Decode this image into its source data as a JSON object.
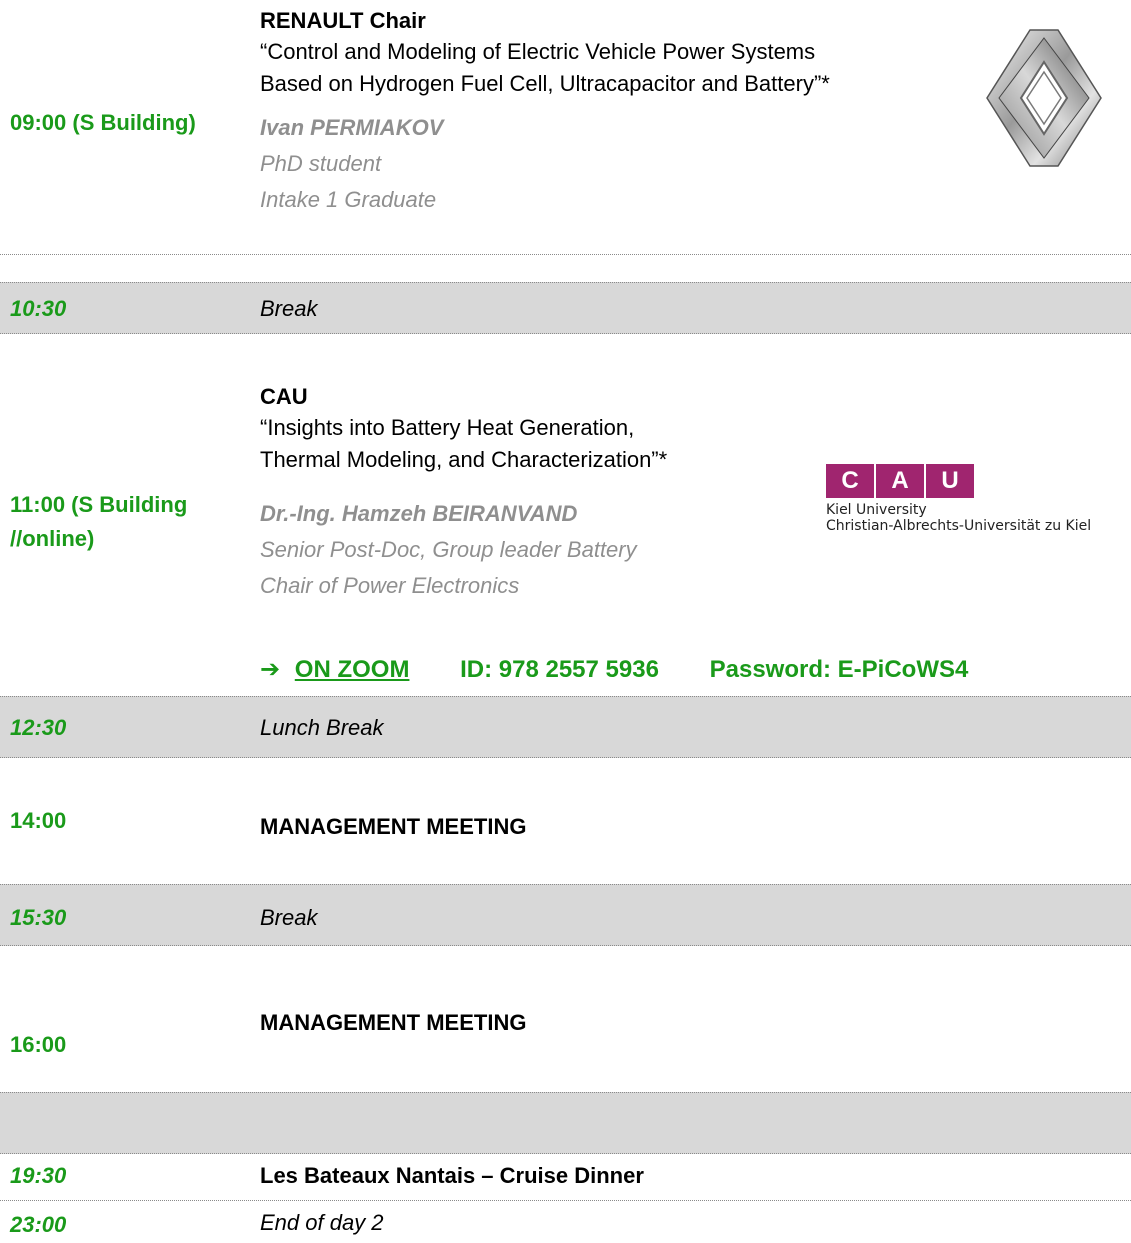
{
  "colors": {
    "time_green": "#1a9a1a",
    "shade_gray": "#d8d8d8",
    "speaker_gray": "#8f8f8f",
    "cau_purple": "#a0256f"
  },
  "session1": {
    "time": "09:00 (S Building)",
    "title": "RENAULT Chair",
    "talk_line1": "“Control and Modeling of Electric Vehicle Power Systems",
    "talk_line2": "Based on Hydrogen Fuel Cell, Ultracapacitor and Battery”*",
    "speaker_name": "Ivan PERMIAKOV",
    "speaker_role1": "PhD student",
    "speaker_role2": "Intake 1 Graduate",
    "logo": "renault-logo"
  },
  "break1": {
    "time": "10:30",
    "label": "Break"
  },
  "session2": {
    "time_line1": "11:00 (S Building",
    "time_line2": "//online)",
    "title": "CAU",
    "talk_line1": "“Insights into Battery Heat Generation,",
    "talk_line2": "Thermal Modeling, and Characterization”*",
    "speaker_name": "Dr.-Ing. Hamzeh BEIRANVAND",
    "speaker_role1": "Senior Post-Doc, Group leader Battery",
    "speaker_role2": "Chair of Power Electronics",
    "logo": {
      "letters": [
        "C",
        "A",
        "U"
      ],
      "line1": "Kiel University",
      "line2": "Christian-Albrechts-Universität zu Kiel"
    },
    "zoom": {
      "arrow": "➔",
      "link_label": "ON ZOOM",
      "id_text": "ID: 978 2557 5936",
      "password_text": "Password:  E-PiCoWS4"
    }
  },
  "lunch": {
    "time": "12:30",
    "label": "Lunch Break"
  },
  "meeting1": {
    "time": "14:00",
    "label": "MANAGEMENT MEETING"
  },
  "break2": {
    "time": "15:30",
    "label": "Break"
  },
  "meeting2": {
    "time": "16:00",
    "label": "MANAGEMENT MEETING"
  },
  "dinner": {
    "time": "19:30",
    "label": "Les Bateaux Nantais – Cruise Dinner"
  },
  "end": {
    "time": "23:00",
    "label": "End of day 2"
  }
}
